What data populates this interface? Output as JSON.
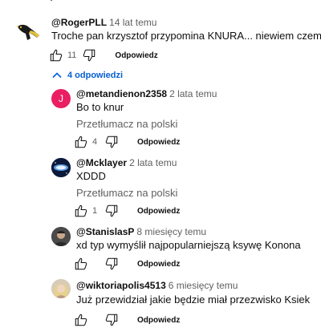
{
  "thread": {
    "top": {
      "author": "@RogerPLL",
      "time": "14 lat temu",
      "text": "Troche pan krzysztof przypomina KNURA... niewiem czemu",
      "likes": "11",
      "reply_label": "Odpowiedz"
    },
    "replies_toggle": "4 odpowiedzi",
    "replies": [
      {
        "author": "@metandienon2358",
        "time": "2 lata temu",
        "text": "Bo to knur",
        "translate": "Przetłumacz na polski",
        "likes": "4",
        "reply_label": "Odpowiedz",
        "avatar_letter": "J",
        "avatar_color": "#e91e63"
      },
      {
        "author": "@Mcklayer",
        "time": "2 lata temu",
        "text": "XDDD",
        "translate": "Przetłumacz na polski",
        "likes": "1",
        "reply_label": "Odpowiedz"
      },
      {
        "author": "@StanislasP",
        "time": "8 miesięcy temu",
        "text": "xd typ wymyślił najpopularniejszą ksywę Konona",
        "likes": "",
        "reply_label": "Odpowiedz"
      },
      {
        "author": "@wiktoriapolis4513",
        "time": "6 miesięcy temu",
        "text": "Już przewidział jakie będzie miał przezwisko Ksiek",
        "likes": "",
        "reply_label": "Odpowiedz"
      }
    ]
  },
  "colors": {
    "link_blue": "#065fd4",
    "muted": "#606060",
    "text": "#0f0f0f"
  }
}
